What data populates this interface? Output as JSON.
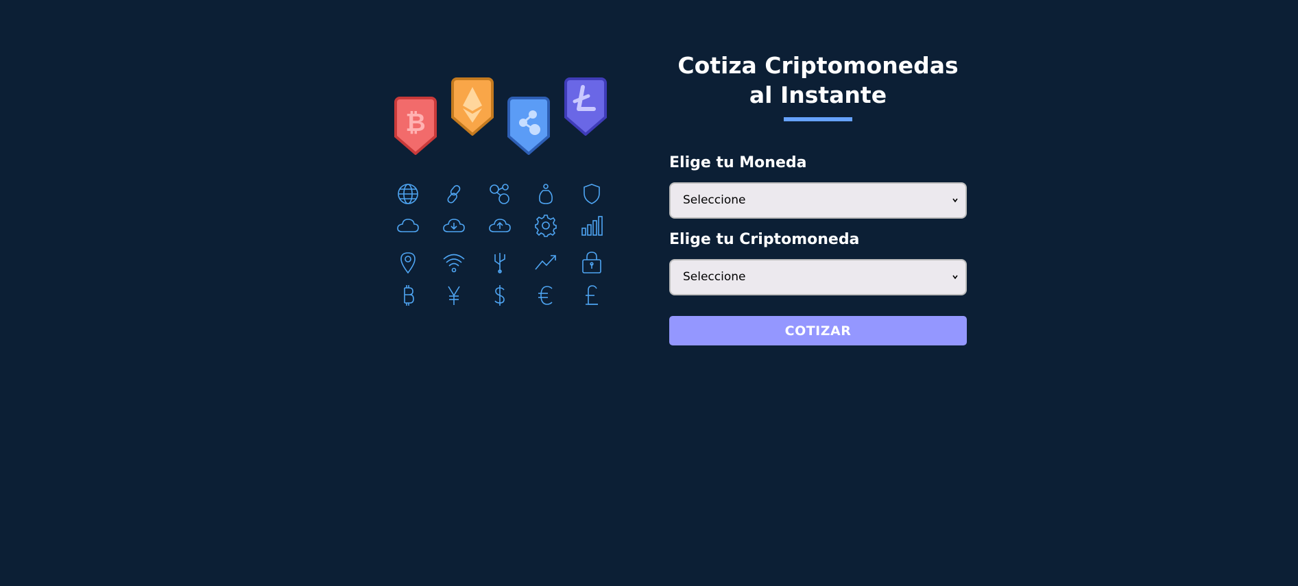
{
  "header": {
    "title": "Cotiza Criptomonedas al Instante"
  },
  "form": {
    "currency_label": "Elige tu Moneda",
    "currency_selected": "Seleccione",
    "crypto_label": "Elige tu Criptomoneda",
    "crypto_selected": "Seleccione",
    "submit_label": "COTIZAR"
  },
  "illustration": {
    "coins": [
      {
        "icon": "bitcoin-icon",
        "color": "#f26b6b"
      },
      {
        "icon": "ethereum-icon",
        "color": "#f9a648"
      },
      {
        "icon": "ripple-icon",
        "color": "#5b9cf6"
      },
      {
        "icon": "litecoin-icon",
        "color": "#6a67e6"
      }
    ],
    "grid_icons": [
      "globe-icon",
      "chain-link-icon",
      "network-nodes-icon",
      "money-bag-icon",
      "shield-icon",
      "cloud-icon",
      "cloud-download-icon",
      "cloud-upload-icon",
      "gear-icon",
      "bar-chart-icon",
      "location-pin-icon",
      "wifi-icon",
      "usb-plug-icon",
      "trending-up-icon",
      "padlock-icon",
      "bitcoin-symbol-icon",
      "yen-icon",
      "dollar-icon",
      "euro-icon",
      "pound-icon"
    ]
  },
  "colors": {
    "background": "#0c1f35",
    "accent_underline": "#66a2fe",
    "button": "#9497ff",
    "icon_line": "#4fa6f4"
  }
}
